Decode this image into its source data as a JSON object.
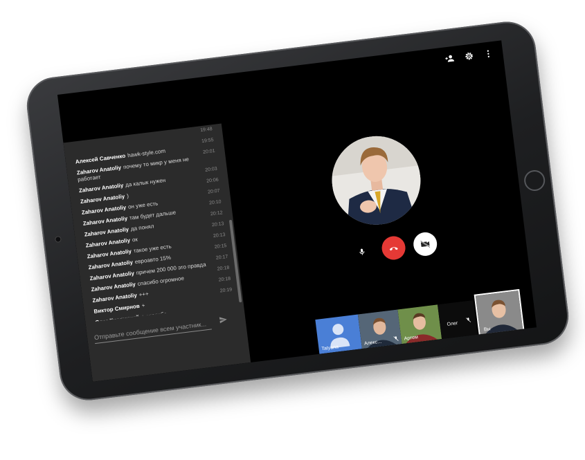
{
  "chat": {
    "messages": [
      {
        "sender": "",
        "text": "",
        "time": "19:48"
      },
      {
        "sender": "Алексей Савченко",
        "text": "hawk-style.com",
        "time": "19:55"
      },
      {
        "sender": "Zaharov Anatoliy",
        "text": "почему то микр у меня не работает",
        "time": "20:01"
      },
      {
        "sender": "Zaharov Anatoliy",
        "text": "да калык нужен",
        "time": "20:03"
      },
      {
        "sender": "Zaharov Anatoliy",
        "text": ")",
        "time": "20:06"
      },
      {
        "sender": "Zaharov Anatoliy",
        "text": "он уже есть",
        "time": "20:07"
      },
      {
        "sender": "Zaharov Anatoliy",
        "text": "там будет дальше",
        "time": "20:10"
      },
      {
        "sender": "Zaharov Anatoliy",
        "text": "да понял",
        "time": "20:12"
      },
      {
        "sender": "Zaharov Anatoliy",
        "text": "ок",
        "time": "20:13"
      },
      {
        "sender": "Zaharov Anatoliy",
        "text": "такое уже есть",
        "time": "20:13"
      },
      {
        "sender": "Zaharov Anatoliy",
        "text": "евроавто 15%",
        "time": "20:15"
      },
      {
        "sender": "Zaharov Anatoliy",
        "text": "причем 200 000 это правда",
        "time": "20:17"
      },
      {
        "sender": "Zaharov Anatoliy",
        "text": "спасибо огромное",
        "time": "20:18"
      },
      {
        "sender": "Zaharov Anatoliy",
        "text": "+++",
        "time": "20:18"
      },
      {
        "sender": "Виктор Смирнов",
        "text": "+",
        "time": "20:19"
      },
      {
        "sender": "Олег Кислицкий",
        "text": "+ спасибо",
        "time": ""
      }
    ],
    "input_placeholder": "Отправьте сообщение всем участник..."
  },
  "participants": [
    {
      "name": "Tatyana",
      "color": "#4a7fd6"
    },
    {
      "name": "Алекс...",
      "muted": true
    },
    {
      "name": "Артем"
    },
    {
      "name": "Олег",
      "muted": true
    }
  ],
  "self_label": "Вы",
  "colors": {
    "hangup": "#e53935",
    "accent_blue": "#4a7fd6",
    "chat_bg": "#2b2b2b"
  }
}
